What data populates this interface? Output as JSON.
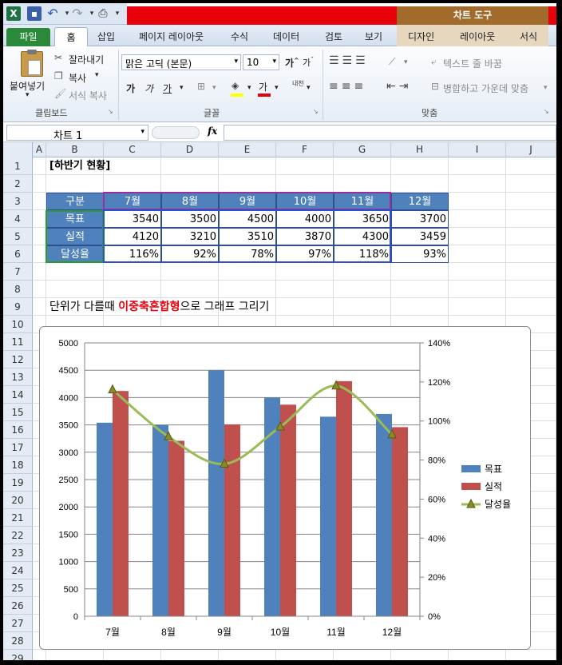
{
  "quick_access": {
    "app_icon": "excel-icon",
    "items": [
      "save-icon",
      "undo-icon",
      "redo-icon",
      "print-preview-icon",
      "customize-icon"
    ]
  },
  "contextual": {
    "title": "차트 도구",
    "tabs": [
      "디자인",
      "레이아웃",
      "서식"
    ]
  },
  "tabs": {
    "file": "파일",
    "home": "홈",
    "insert": "삽입",
    "page_layout": "페이지 레이아웃",
    "formulas": "수식",
    "data": "데이터",
    "review": "검토",
    "view": "보기"
  },
  "clipboard": {
    "paste": "붙여넣기",
    "cut": "잘라내기",
    "copy": "복사",
    "format_painter": "서식 복사",
    "label": "클립보드"
  },
  "font": {
    "name": "맑은 고딕 (본문)",
    "size": "10",
    "bold": "가",
    "italic": "가",
    "underline": "가",
    "color_letter": "가",
    "label": "글꼴",
    "phonetic": "내천"
  },
  "alignment": {
    "wrap": "텍스트 줄 바꿈",
    "merge": "병합하고 가운데 맞춤",
    "label": "맞춤"
  },
  "formula_bar": {
    "name_box": "차트 1",
    "fx": "fx",
    "value": ""
  },
  "columns": [
    "A",
    "B",
    "C",
    "D",
    "E",
    "F",
    "G",
    "H",
    "I",
    "J"
  ],
  "rows": [
    "1",
    "2",
    "3",
    "4",
    "5",
    "6",
    "7",
    "8",
    "9",
    "10",
    "11",
    "12",
    "13",
    "14",
    "15",
    "16",
    "17",
    "18",
    "19",
    "20",
    "21",
    "22",
    "23",
    "24",
    "25",
    "26",
    "27",
    "28",
    "29"
  ],
  "sheet": {
    "title": "[하반기 현황]",
    "table": {
      "headers": [
        "구분",
        "7월",
        "8월",
        "9월",
        "10월",
        "11월",
        "12월"
      ],
      "rows": [
        {
          "label": "목표",
          "values": [
            "3540",
            "3500",
            "4500",
            "4000",
            "3650",
            "3700"
          ]
        },
        {
          "label": "실적",
          "values": [
            "4120",
            "3210",
            "3510",
            "3870",
            "4300",
            "3459"
          ]
        },
        {
          "label": "달성율",
          "values": [
            "116%",
            "92%",
            "78%",
            "97%",
            "118%",
            "93%"
          ]
        }
      ]
    },
    "note_before": "단위가 다를때 ",
    "note_highlight": "이중축혼합형",
    "note_after": "으로 그래프 그리기",
    "note_highlight_color": "#e8000a"
  },
  "chart_data": {
    "type": "bar",
    "categories": [
      "7월",
      "8월",
      "9월",
      "10월",
      "11월",
      "12월"
    ],
    "series": [
      {
        "name": "목표",
        "type": "bar",
        "axis": "left",
        "color": "#4f81bd",
        "values": [
          3540,
          3500,
          4500,
          4000,
          3650,
          3700
        ]
      },
      {
        "name": "실적",
        "type": "bar",
        "axis": "left",
        "color": "#c0504d",
        "values": [
          4120,
          3210,
          3510,
          3870,
          4300,
          3459
        ]
      },
      {
        "name": "달성율",
        "type": "line",
        "axis": "right",
        "color": "#9bbb59",
        "values": [
          116,
          92,
          78,
          97,
          118,
          93
        ]
      }
    ],
    "ylim": [
      0,
      5000
    ],
    "yticks": [
      "0",
      "500",
      "1000",
      "1500",
      "2000",
      "2500",
      "3000",
      "3500",
      "4000",
      "4500",
      "5000"
    ],
    "y2lim": [
      0,
      140
    ],
    "y2ticks": [
      "0%",
      "20%",
      "40%",
      "60%",
      "80%",
      "100%",
      "120%",
      "140%"
    ],
    "grid": true,
    "legend": "right"
  },
  "colors": {
    "excel_green": "#217346",
    "header_blue": "#4f81bd",
    "ribbon_bg": "#e6edf6",
    "contextual_tab": "#a36b2b"
  }
}
